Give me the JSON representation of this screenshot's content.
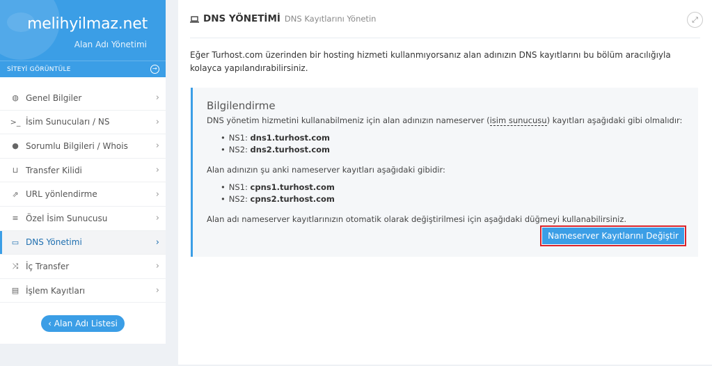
{
  "sidebar": {
    "site_name": "melihyilmaz.net",
    "site_subtitle": "Alan Adı Yönetimi",
    "view_site_label": "SİTEYİ GÖRÜNTÜLE",
    "items": [
      {
        "label": "Genel Bilgiler",
        "icon": "globe-icon"
      },
      {
        "label": "İsim Sunucuları / NS",
        "icon": "terminal-icon"
      },
      {
        "label": "Sorumlu Bilgileri / Whois",
        "icon": "user-icon"
      },
      {
        "label": "Transfer Kilidi",
        "icon": "unlock-icon"
      },
      {
        "label": "URL yönlendirme",
        "icon": "external-link-icon"
      },
      {
        "label": "Özel İsim Sunucusu",
        "icon": "list-icon"
      },
      {
        "label": "DNS Yönetimi",
        "icon": "laptop-icon",
        "active": true
      },
      {
        "label": "İç Transfer",
        "icon": "shuffle-icon"
      },
      {
        "label": "İşlem Kayıtları",
        "icon": "table-icon"
      }
    ],
    "list_button_label": "‹ Alan Adı Listesi"
  },
  "panel": {
    "title": "DNS YÖNETİMİ",
    "subtitle": "DNS Kayıtlarını Yönetin",
    "intro": "Eğer Turhost.com üzerinden bir hosting hizmeti kullanmıyorsanız alan adınızın DNS kayıtlarını bu bölüm aracılığıyla kolayca yapılandırabilirsiniz.",
    "info": {
      "heading": "Bilgilendirme",
      "text1_before": "DNS yönetim hizmetini kullanabilmeniz için alan adınızın nameserver (",
      "text1_link": "isim sunucusu",
      "text1_after": ") kayıtları aşağıdaki gibi olmalıdır:",
      "required_ns": [
        {
          "label": "NS1:",
          "value": "dns1.turhost.com"
        },
        {
          "label": "NS2:",
          "value": "dns2.turhost.com"
        }
      ],
      "text2": "Alan adınızın şu anki nameserver kayıtları aşağıdaki gibidir:",
      "current_ns": [
        {
          "label": "NS1:",
          "value": "cpns1.turhost.com"
        },
        {
          "label": "NS2:",
          "value": "cpns2.turhost.com"
        }
      ],
      "text3": "Alan adı nameserver kayıtlarınızın otomatik olarak değiştirilmesi için aşağıdaki düğmeyi kullanabilirsiniz.",
      "button_label": "Nameserver Kayıtlarını Değiştir"
    }
  },
  "colors": {
    "accent": "#3b9ee6",
    "highlight_border": "#d9232a"
  }
}
